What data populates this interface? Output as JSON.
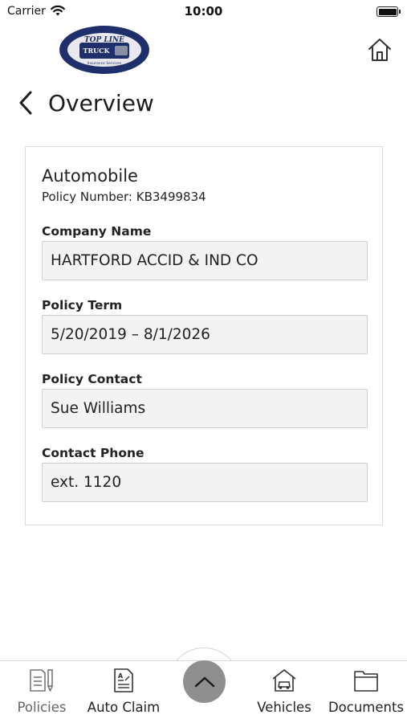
{
  "status_bar": {
    "carrier": "Carrier",
    "time": "10:00"
  },
  "header": {
    "logo_text_top": "TOP LINE",
    "logo_text_mid": "TRUCK",
    "logo_text_bottom": "Insurance Services",
    "logo_colors": {
      "ring": "#1f2f6b",
      "inner": "#e8e8ee"
    }
  },
  "page": {
    "title": "Overview"
  },
  "policy": {
    "type": "Automobile",
    "number_line": "Policy Number: KB3499834",
    "fields": [
      {
        "label": "Company Name",
        "value": "HARTFORD ACCID & IND CO"
      },
      {
        "label": "Policy Term",
        "value": "5/20/2019 – 8/1/2026"
      },
      {
        "label": "Policy Contact",
        "value": "Sue Williams"
      },
      {
        "label": "Contact Phone",
        "value": "ext. 1120"
      }
    ]
  },
  "bottom_nav": {
    "items": [
      {
        "label": "Policies",
        "icon": "policies-icon",
        "active": true
      },
      {
        "label": "Auto Claim",
        "icon": "auto-claim-icon",
        "active": false
      },
      {
        "label": "Vehicles",
        "icon": "vehicles-icon",
        "active": false
      },
      {
        "label": "Documents",
        "icon": "documents-icon",
        "active": false
      }
    ],
    "center_button_icon": "chevron-up-icon",
    "center_button_color": "#8f8f8f"
  }
}
